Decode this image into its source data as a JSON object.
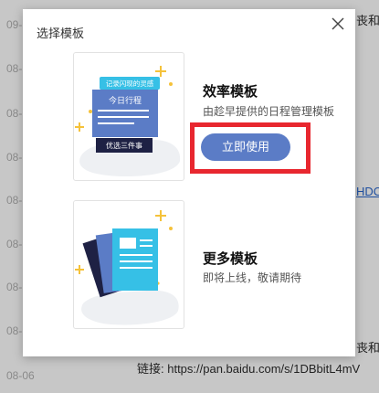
{
  "background": {
    "dates": [
      "09-",
      "08-",
      "08-",
      "08-",
      "08-",
      "08-",
      "08-",
      "08-",
      "08-",
      "08-06"
    ],
    "snippets": {
      "top_right": "丧和",
      "link_fragment": "HDC",
      "bottom_right": "丧和",
      "link_line": "链接: https://pan.baidu.com/s/1DBbitL4mV"
    }
  },
  "modal": {
    "title": "选择模板",
    "close_icon": "close-icon",
    "templates": [
      {
        "title": "效率模板",
        "description": "由趁早提供的日程管理模板",
        "button_label": "立即使用",
        "thumbnail": {
          "tag": "记录闪现的灵感",
          "card_title": "今日行程",
          "footer": "优选三件事"
        }
      },
      {
        "title": "更多模板",
        "description": "即将上线，敬请期待"
      }
    ]
  },
  "colors": {
    "accent_blue": "#5b7cc6",
    "highlight_red": "#e8272f",
    "sparkle_yellow": "#f5c23a",
    "cyan": "#36c0e6",
    "dark_navy": "#1e2144"
  }
}
